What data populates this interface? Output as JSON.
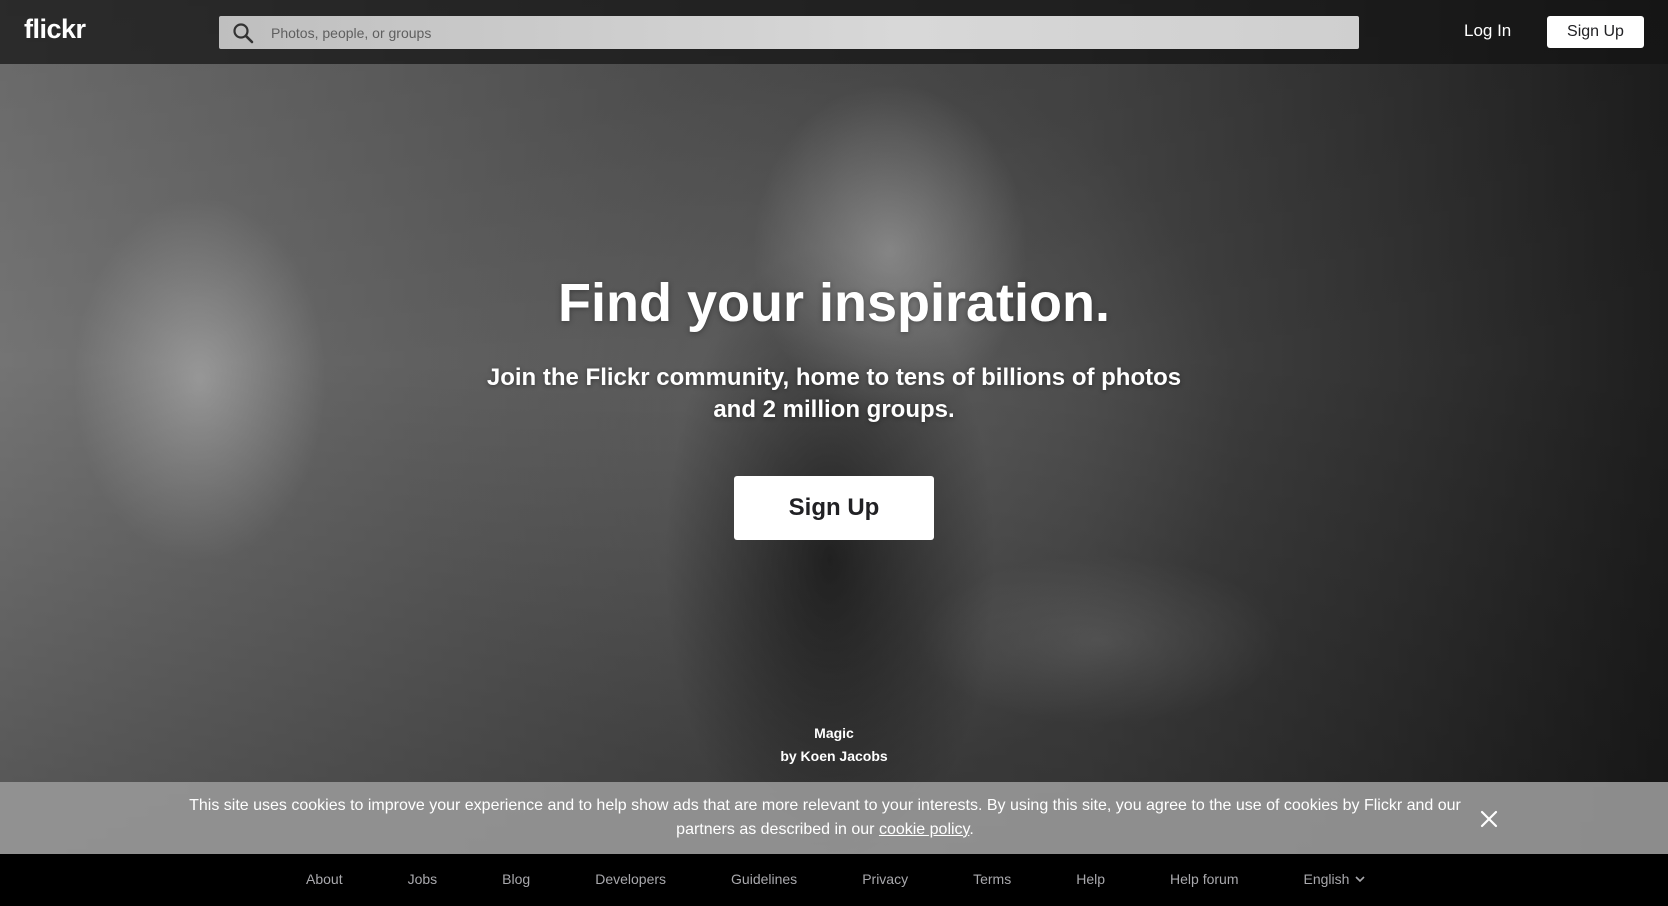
{
  "header": {
    "logo": "flickr",
    "search_placeholder": "Photos, people, or groups",
    "login_label": "Log In",
    "signup_label": "Sign Up"
  },
  "hero": {
    "headline": "Find your inspiration.",
    "subline": "Join the Flickr community, home to tens of billions of photos and 2 million groups.",
    "signup_label": "Sign Up",
    "photo_title": "Magic",
    "photo_credit": "by Koen Jacobs"
  },
  "cookie_banner": {
    "text": "This site uses cookies to improve your experience and to help show ads that are more relevant to your interests. By using this site, you agree to the use of cookies by Flickr and our partners as described in our",
    "link_text": "cookie policy",
    "suffix": "."
  },
  "footer": {
    "links": [
      "About",
      "Jobs",
      "Blog",
      "Developers",
      "Guidelines",
      "Privacy",
      "Terms",
      "Help",
      "Help forum"
    ],
    "language": "English"
  },
  "icons": {
    "search": "search-icon",
    "close": "close-icon",
    "chevron": "chevron-down-icon"
  }
}
